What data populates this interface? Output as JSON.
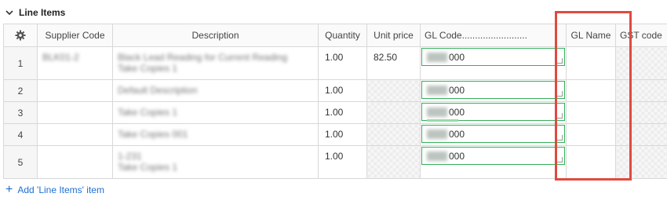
{
  "section": {
    "title": "Line Items"
  },
  "columns": {
    "settings_icon": "gear-icon",
    "supplier_code": "Supplier Code",
    "description": "Description",
    "quantity": "Quantity",
    "unit_price": "Unit price",
    "gl_code": "GL Code.........................",
    "gl_name": "GL Name",
    "gst_code": "GST code"
  },
  "rows": [
    {
      "num": "1",
      "supplier_code": "BLK01-2",
      "description_line1": "Black Lead Reading for Current Reading",
      "description_line2": "Take Copies 1",
      "quantity": "1.00",
      "unit_price": "82.50",
      "gl_code_tail": "000",
      "gl_name": ""
    },
    {
      "num": "2",
      "supplier_code": "",
      "description_line1": "Default Description",
      "description_line2": "",
      "quantity": "1.00",
      "unit_price": "",
      "gl_code_tail": "000",
      "gl_name": ""
    },
    {
      "num": "3",
      "supplier_code": "",
      "description_line1": "Take Copies 1",
      "description_line2": "",
      "quantity": "1.00",
      "unit_price": "",
      "gl_code_tail": "000",
      "gl_name": ""
    },
    {
      "num": "4",
      "supplier_code": "",
      "description_line1": "Take Copies 001",
      "description_line2": "",
      "quantity": "1.00",
      "unit_price": "",
      "gl_code_tail": "000",
      "gl_name": ""
    },
    {
      "num": "5",
      "supplier_code": "",
      "description_line1": "1-231",
      "description_line2": "Take Copies 1",
      "quantity": "1.00",
      "unit_price": "",
      "gl_code_tail": "000",
      "gl_name": ""
    }
  ],
  "footer": {
    "add_item_label": "Add 'Line Items' item"
  },
  "colors": {
    "accent": "#1f6fd1",
    "gl_border": "#34b05a",
    "highlight": "#e04a3f"
  }
}
